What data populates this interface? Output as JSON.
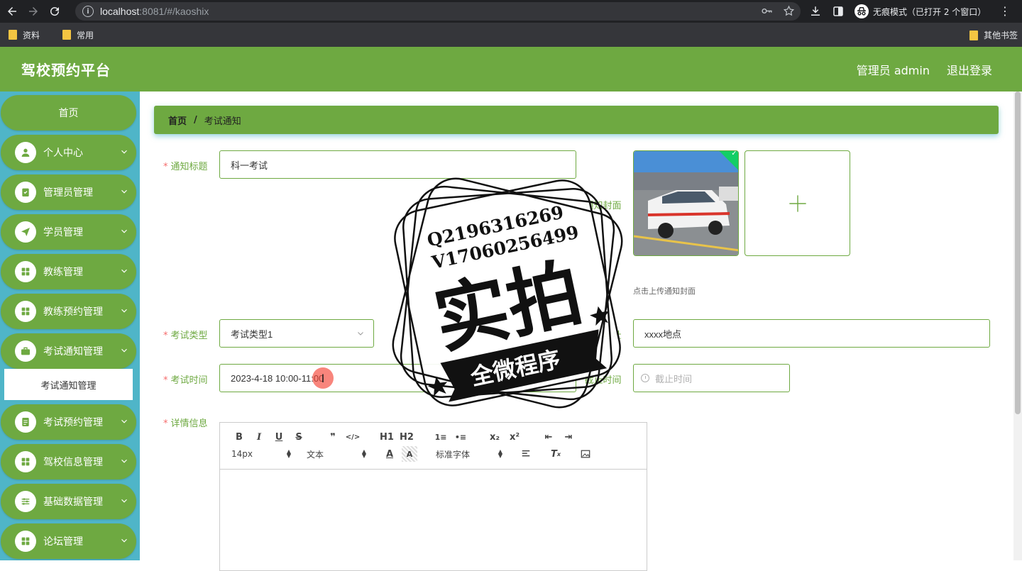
{
  "browser": {
    "url_host": "localhost",
    "url_rest": ":8081/#/kaoshix",
    "incognito_label": "无痕模式（已打开 2 个窗口）",
    "bookmarks": [
      {
        "label": "资料"
      },
      {
        "label": "常用"
      }
    ],
    "other_bookmarks": "其他书签"
  },
  "header": {
    "brand": "驾校预约平台",
    "user_label": "管理员 admin",
    "logout_label": "退出登录"
  },
  "sidebar": {
    "home_label": "首页",
    "items": [
      {
        "label": "个人中心",
        "icon": "user-icon"
      },
      {
        "label": "管理员管理",
        "icon": "clipboard-icon"
      },
      {
        "label": "学员管理",
        "icon": "send-icon"
      },
      {
        "label": "教练管理",
        "icon": "grid-icon"
      },
      {
        "label": "教练预约管理",
        "icon": "grid-icon"
      },
      {
        "label": "考试通知管理",
        "icon": "briefcase-icon"
      },
      {
        "label": "考试预约管理",
        "icon": "document-icon"
      },
      {
        "label": "驾校信息管理",
        "icon": "grid-icon"
      },
      {
        "label": "基础数据管理",
        "icon": "sliders-icon"
      },
      {
        "label": "论坛管理",
        "icon": "grid-icon"
      }
    ],
    "submenu_label": "考试通知管理"
  },
  "breadcrumb": {
    "home": "首页",
    "separator": "/",
    "current": "考试通知"
  },
  "form": {
    "title_label": "通知标题",
    "title_value": "科一考试",
    "cover_label": "通知封面",
    "cover_tip": "点击上传通知封面",
    "exam_type_label": "考试类型",
    "exam_type_value": "考试类型1",
    "exam_location_label": "考试地址",
    "exam_location_value": "xxxx地点",
    "exam_time_label": "考试时间",
    "exam_time_value": "2023-4-18 10:00-11:00",
    "deadline_label": "截止时间",
    "deadline_placeholder": "截止时间",
    "detail_label": "详情信息",
    "required_mark": "*"
  },
  "editor": {
    "row1": [
      "B",
      "I",
      "U",
      "S",
      "❞",
      "</>",
      "H1",
      "H2",
      "1≡",
      "•≡",
      "x₂",
      "x²",
      "⇤",
      "⇥"
    ],
    "font_size": "14px",
    "paragraph": "文本",
    "font_family": "标准字体"
  },
  "watermark": {
    "line1": "Q2196316269",
    "line2": "V17060256499",
    "big": "实拍",
    "banner": "全微程序"
  },
  "colors": {
    "primary": "#6ea941",
    "sidebar_bg": "#4fb5c8",
    "required": "#f56c6c"
  }
}
